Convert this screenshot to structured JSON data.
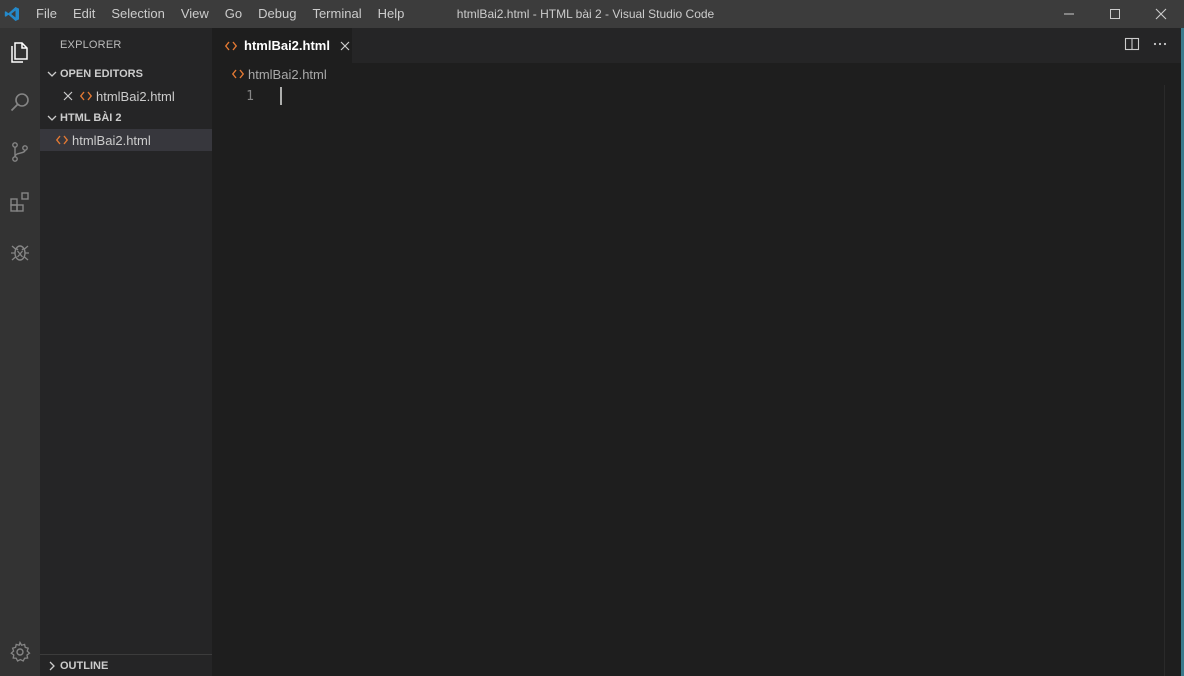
{
  "titlebar": {
    "menu": [
      "File",
      "Edit",
      "Selection",
      "View",
      "Go",
      "Debug",
      "Terminal",
      "Help"
    ],
    "title": "htmlBai2.html - HTML bài 2 - Visual Studio Code",
    "logo_icon": "vscode-logo-icon",
    "controls": [
      "minimize-icon",
      "maximize-icon",
      "close-icon"
    ]
  },
  "activitybar": {
    "items": [
      "files-icon",
      "search-icon",
      "source-control-icon",
      "extensions-icon",
      "debug-icon"
    ],
    "bottom": "gear-icon"
  },
  "sidebar": {
    "header": "EXPLORER",
    "open_editors": {
      "label": "OPEN EDITORS",
      "files": [
        {
          "name": "htmlBai2.html"
        }
      ]
    },
    "folder": {
      "label": "HTML BÀI 2",
      "files": [
        {
          "name": "htmlBai2.html"
        }
      ]
    },
    "outline": {
      "label": "OUTLINE"
    }
  },
  "editor": {
    "tab": {
      "label": "htmlBai2.html"
    },
    "breadcrumb": "htmlBai2.html",
    "lines": [
      "1"
    ],
    "actions": [
      "split-editor-icon",
      "more-actions-icon"
    ]
  },
  "colors": {
    "accent_orange": "#e37933",
    "vscode_blue": "#2489ca"
  }
}
